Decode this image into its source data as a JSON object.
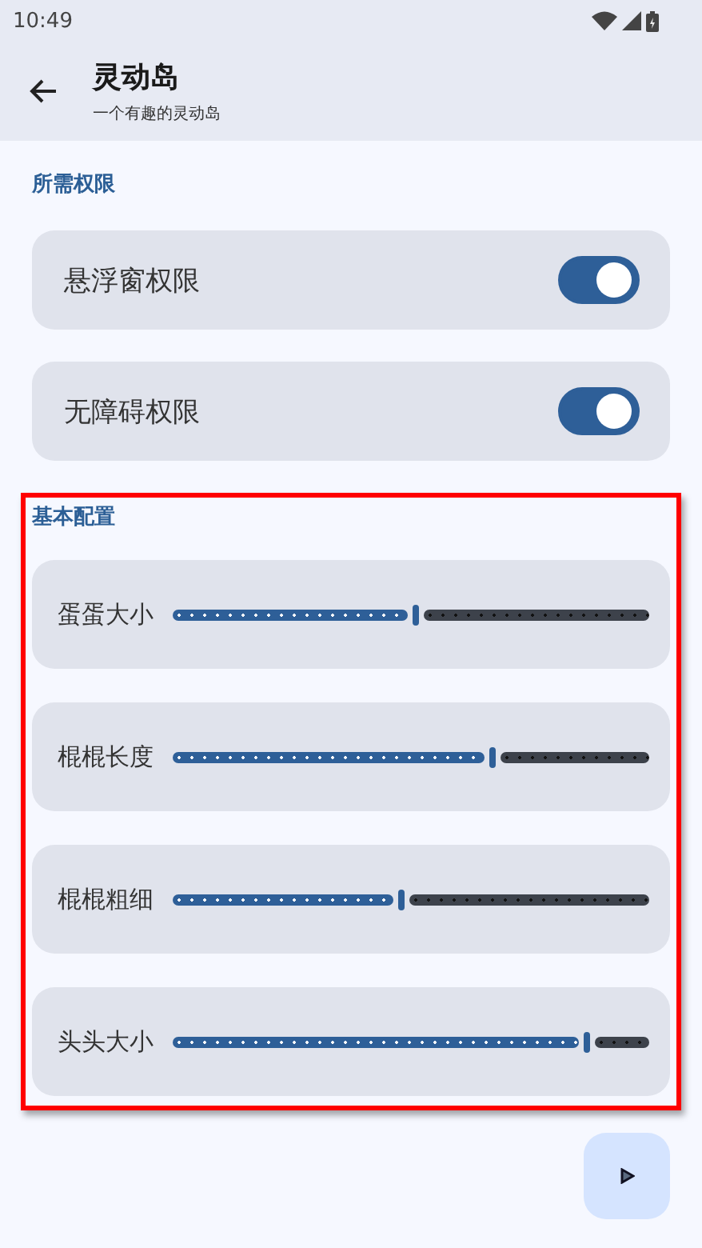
{
  "status_bar": {
    "time": "10:49"
  },
  "app_bar": {
    "title": "灵动岛",
    "subtitle": "一个有趣的灵动岛"
  },
  "sections": [
    {
      "title": "所需权限",
      "highlighted": false,
      "items": [
        {
          "kind": "switch",
          "label": "悬浮窗权限",
          "on": true
        },
        {
          "kind": "switch",
          "label": "无障碍权限",
          "on": true
        }
      ]
    },
    {
      "title": "基本配置",
      "highlighted": true,
      "items": [
        {
          "kind": "slider",
          "label": "蛋蛋大小",
          "level": 0.51
        },
        {
          "kind": "slider",
          "label": "棍棍长度",
          "level": 0.67
        },
        {
          "kind": "slider",
          "label": "棍棍粗细",
          "level": 0.48
        },
        {
          "kind": "slider",
          "label": "头头大小",
          "level": 0.87
        }
      ]
    }
  ]
}
